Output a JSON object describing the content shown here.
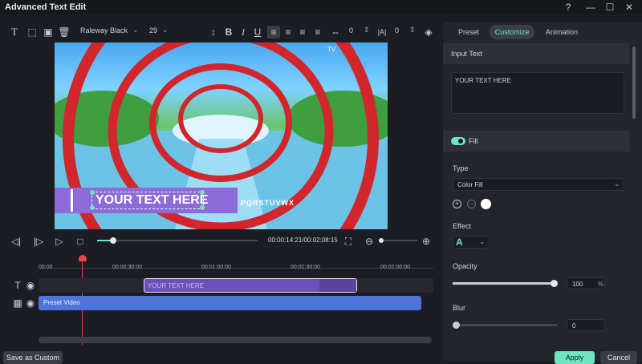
{
  "window": {
    "title": "Advanced Text Edit"
  },
  "toolbar": {
    "font_name": "Raleway Black",
    "font_size": "29",
    "letter_spacing": "0",
    "line_spacing": "0"
  },
  "preview": {
    "text_overlay": "YOUR TEXT HERE",
    "ticker_text": "PQRSTUVWX",
    "watermark": "TV"
  },
  "playback": {
    "time_display": "00:00:14:21/00:02:08:15",
    "progress": 0.1
  },
  "timeline": {
    "ruler": [
      "00:00",
      "00:00:30:00",
      "00:01:00:00",
      "00:01:30:00",
      "00:02:00:00"
    ],
    "text_clip_label": "YOUR TEXT HERE",
    "video_clip_label": "Preset Video"
  },
  "panel": {
    "tabs": [
      "Preset",
      "Customize",
      "Animation"
    ],
    "active_tab": "Customize",
    "input_text_header": "Input Text",
    "input_text_value": "YOUR TEXT HERE",
    "fill_label": "Fill",
    "type_label": "Type",
    "type_value": "Color Fill",
    "effect_label": "Effect",
    "effect_glyph": "A",
    "opacity_label": "Opacity",
    "opacity_value": "100",
    "opacity_unit": "%",
    "opacity_level": 1.0,
    "blur_label": "Blur",
    "blur_value": "0",
    "blur_level": 0.0
  },
  "buttons": {
    "save_custom": "Save as Custom",
    "apply": "Apply",
    "cancel": "Cancel"
  },
  "colors": {
    "accent": "#6fe6c2",
    "text_clip": "#7b5fd0",
    "video_clip": "#4f73d9",
    "playhead": "#e2474a"
  }
}
